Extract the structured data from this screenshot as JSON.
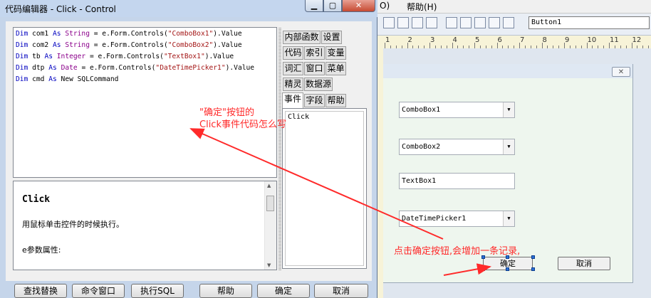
{
  "editor": {
    "title": "代码编辑器 - Click - Control",
    "window_buttons": {
      "minimize": "▁",
      "maximize": "▢",
      "close": "✕"
    },
    "code_lines": [
      [
        {
          "t": "Dim",
          "c": "kw"
        },
        {
          "t": " com1 "
        },
        {
          "t": "As",
          "c": "kw"
        },
        {
          "t": " "
        },
        {
          "t": "String",
          "c": "ty"
        },
        {
          "t": " = e.Form.Controls("
        },
        {
          "t": "\"ComboBox1\"",
          "c": "str"
        },
        {
          "t": ").Value"
        }
      ],
      [
        {
          "t": "Dim",
          "c": "kw"
        },
        {
          "t": " com2 "
        },
        {
          "t": "As",
          "c": "kw"
        },
        {
          "t": " "
        },
        {
          "t": "String",
          "c": "ty"
        },
        {
          "t": " = e.Form.Controls("
        },
        {
          "t": "\"ComboBox2\"",
          "c": "str"
        },
        {
          "t": ").Value"
        }
      ],
      [
        {
          "t": "Dim",
          "c": "kw"
        },
        {
          "t": " tb "
        },
        {
          "t": "As",
          "c": "kw"
        },
        {
          "t": " "
        },
        {
          "t": "Integer",
          "c": "ty"
        },
        {
          "t": " = e.Form.Controls("
        },
        {
          "t": "\"TextBox1\"",
          "c": "str"
        },
        {
          "t": ").Value"
        }
      ],
      [
        {
          "t": "Dim",
          "c": "kw"
        },
        {
          "t": " dtp "
        },
        {
          "t": "As",
          "c": "kw"
        },
        {
          "t": " "
        },
        {
          "t": "Date",
          "c": "ty"
        },
        {
          "t": " = e.Form.Controls("
        },
        {
          "t": "\"DateTimePicker1\"",
          "c": "str"
        },
        {
          "t": ").Value"
        }
      ],
      [
        {
          "t": "Dim",
          "c": "kw"
        },
        {
          "t": " cmd "
        },
        {
          "t": "As",
          "c": "kw"
        },
        {
          "t": " New SQLCommand"
        }
      ]
    ],
    "help": {
      "title": "Click",
      "description": "用鼠标单击控件的时候执行。",
      "params": "e参数属性:"
    },
    "tabs": {
      "row1": [
        "内部函数",
        "设置"
      ],
      "row2": [
        "代码",
        "索引",
        "变量"
      ],
      "row3": [
        "词汇",
        "窗口",
        "菜单"
      ],
      "row4": [
        "精灵",
        "数据源"
      ],
      "row5": [
        "事件",
        "字段",
        "帮助"
      ]
    },
    "active_tab": "事件",
    "event_item": "Click",
    "buttons": [
      "查找替换",
      "命令窗口",
      "执行SQL",
      "帮助",
      "确定",
      "取消"
    ]
  },
  "designer": {
    "menu": [
      "O)",
      "帮助(H)"
    ],
    "control_select": "Button1",
    "ruler_numbers": [
      "1",
      "2",
      "3",
      "4",
      "5",
      "6",
      "7",
      "8",
      "9",
      "10",
      "11",
      "12"
    ],
    "form_close": "✕",
    "controls": {
      "combo1": "ComboBox1",
      "combo2": "ComboBox2",
      "textbox1": "TextBox1",
      "datetime1": "DateTimePicker1",
      "dropdown_glyph": "▼",
      "confirm_button": "确定",
      "cancel_button": "取消"
    }
  },
  "annotations": {
    "note1_line1": "\"确定\"按钮的",
    "note1_line2": "Click事件代码怎么写",
    "note2": "点击确定按钮,会增加一条记录,",
    "color": "#ff2a2a"
  }
}
